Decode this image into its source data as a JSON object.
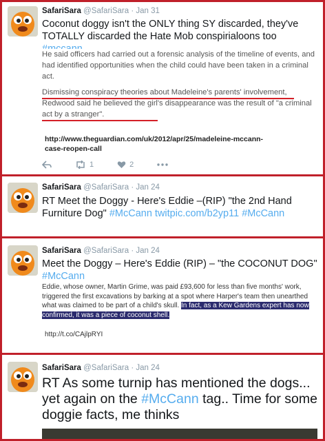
{
  "colors": {
    "border": "#c0202a",
    "hashtag": "#55acee",
    "meta": "#8899a6",
    "highlight": "#2b2b6e"
  },
  "tweets": [
    {
      "name": "SafariSara",
      "handle": "@SafariSara",
      "date": "· Jan 31",
      "text_pre": "Coconut doggy isn't the ONLY thing SY discarded, they've TOTALLY discarded the Hate Mob conspirialoons too ",
      "hashtag": "#mccann",
      "quote_para1": "He said officers had carried out a forensic analysis of the timeline of events, and had identified opportunities when the child could have been taken in a criminal act.",
      "quote_para2": "Dismissing conspiracy theories about Madeleine's parents' involvement, Redwood said he believed the girl's disappearance was the result of \"a criminal act by a stranger\".",
      "link": "http://www.theguardian.com/uk/2012/apr/25/madeleine-mccann-case-reopen-call",
      "retweets": "1",
      "likes": "2",
      "icons": [
        "reply-icon",
        "retweet-icon",
        "like-icon",
        "more-icon"
      ]
    },
    {
      "name": "SafariSara",
      "handle": "@SafariSara",
      "date": "· Jan 24",
      "text_pre": "RT Meet the Doggy - Here's Eddie  –(RIP)  \"the 2nd Hand Furniture Dog\" ",
      "hashtag1": "#McCann",
      "link": " twitpic.com/b2yp11 ",
      "hashtag2": "#McCann"
    },
    {
      "name": "SafariSara",
      "handle": "@SafariSara",
      "date": "· Jan 24",
      "text_pre": "Meet the Doggy  – Here's Eddie (RIP) – \"the COCONUT DOG\" ",
      "hashtag": "#McCann",
      "image_text": "Eddie, whose owner, Martin Grime, was paid £93,600 for less than five months' work, triggered the first excavations by barking at a spot where Harper's team then unearthed what was claimed to be part of a child's skull. ",
      "image_highlight": "In fact, as a Kew Gardens expert has now confirmed, it was a piece of coconut shell.",
      "image_link": "http://t.co/CAjlpRYI"
    },
    {
      "name": "SafariSara",
      "handle": "@SafariSara",
      "date": "· Jan 24",
      "text_pre": "RT As some turnip has mentioned the dogs... yet again on the ",
      "hashtag": "#McCann",
      "text_post": " tag.. Time for some doggie facts, me thinks"
    }
  ]
}
